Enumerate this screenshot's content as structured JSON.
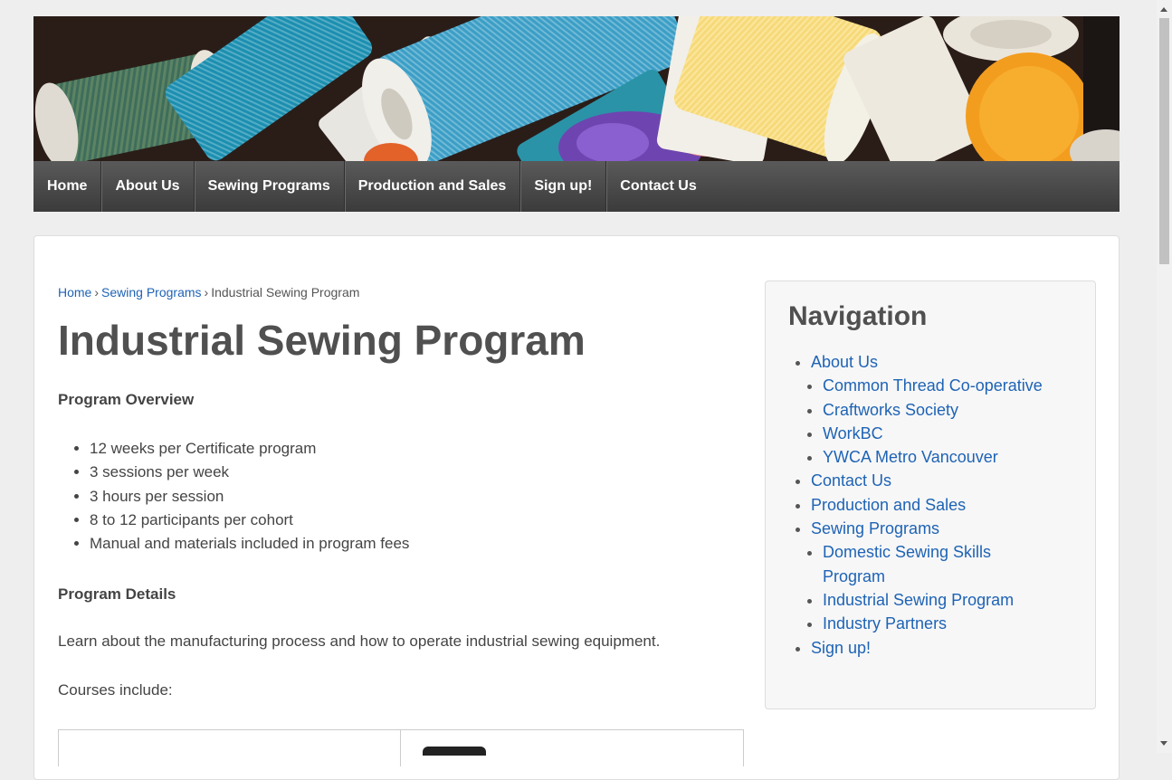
{
  "nav": {
    "items": [
      {
        "label": "Home"
      },
      {
        "label": "About Us"
      },
      {
        "label": "Sewing Programs"
      },
      {
        "label": "Production and Sales"
      },
      {
        "label": "Sign up!"
      },
      {
        "label": "Contact Us"
      }
    ]
  },
  "breadcrumb": {
    "home": "Home",
    "separator": "›",
    "parent": "Sewing Programs",
    "current": "Industrial Sewing Program"
  },
  "main": {
    "title": "Industrial Sewing Program",
    "overview_heading": "Program Overview",
    "overview_items": [
      "12 weeks per Certificate program",
      "3 sessions per week",
      "3 hours per session",
      "8 to 12 participants per cohort",
      "Manual and materials included in program fees"
    ],
    "details_heading": "Program Details",
    "details_text": "Learn about the manufacturing process and how to operate industrial sewing equipment.",
    "courses_intro": "Courses include:"
  },
  "sidebar": {
    "title": "Navigation",
    "about": "About Us",
    "about_children": [
      "Common Thread Co-operative",
      "Craftworks Society",
      "WorkBC",
      "YWCA Metro Vancouver"
    ],
    "contact": "Contact Us",
    "production": "Production and Sales",
    "sewing": "Sewing Programs",
    "sewing_children": [
      "Domestic Sewing Skills Program",
      "Industrial Sewing Program",
      "Industry Partners"
    ],
    "signup": "Sign up!"
  },
  "colors": {
    "link": "#1e63b5",
    "nav_bg": "#4a4a4a",
    "heading": "#505050"
  }
}
